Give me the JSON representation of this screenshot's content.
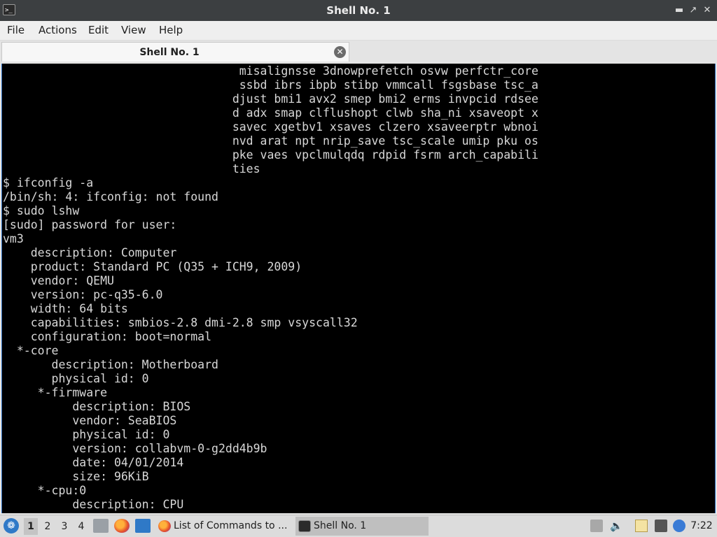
{
  "window": {
    "title": "Shell No. 1",
    "icon_glyph": ">_",
    "controls": [
      "minimize-icon",
      "maximize-icon",
      "close-icon"
    ]
  },
  "menu": {
    "items": [
      "File",
      "Actions",
      "Edit",
      "View",
      "Help"
    ]
  },
  "tabs": [
    {
      "label": "Shell No. 1",
      "close_icon": "close-circle-icon"
    }
  ],
  "terminal": {
    "colors": {
      "background": "#000000",
      "text": "#d8d8d8"
    },
    "lines": [
      "                                  misalignsse 3dnowprefetch osvw perfctr_core",
      "                                  ssbd ibrs ibpb stibp vmmcall fsgsbase tsc_a",
      "                                 djust bmi1 avx2 smep bmi2 erms invpcid rdsee",
      "                                 d adx smap clflushopt clwb sha_ni xsaveopt x",
      "                                 savec xgetbv1 xsaves clzero xsaveerptr wbnoi",
      "                                 nvd arat npt nrip_save tsc_scale umip pku os",
      "                                 pke vaes vpclmulqdq rdpid fsrm arch_capabili",
      "                                 ties",
      "$ ifconfig -a",
      "/bin/sh: 4: ifconfig: not found",
      "$ sudo lshw",
      "[sudo] password for user:",
      "vm3",
      "    description: Computer",
      "    product: Standard PC (Q35 + ICH9, 2009)",
      "    vendor: QEMU",
      "    version: pc-q35-6.0",
      "    width: 64 bits",
      "    capabilities: smbios-2.8 dmi-2.8 smp vsyscall32",
      "    configuration: boot=normal",
      "  *-core",
      "       description: Motherboard",
      "       physical id: 0",
      "     *-firmware",
      "          description: BIOS",
      "          vendor: SeaBIOS",
      "          physical id: 0",
      "          version: collabvm-0-g2dd4b9b",
      "          date: 04/01/2014",
      "          size: 96KiB",
      "     *-cpu:0",
      "          description: CPU"
    ]
  },
  "taskbar": {
    "start_icon": "start-menu-icon",
    "workspaces": [
      "1",
      "2",
      "3",
      "4"
    ],
    "active_workspace": "1",
    "launchers": [
      "file-manager-icon",
      "firefox-icon",
      "show-desktop-icon"
    ],
    "tasks": [
      {
        "label": "List of Commands to ...",
        "icon": "firefox-icon",
        "active": false
      },
      {
        "label": "Shell No. 1",
        "icon": "terminal-icon",
        "active": true
      }
    ],
    "tray": [
      "notification-icon",
      "volume-icon",
      "clipboard-icon",
      "network-icon",
      "update-notifier-icon"
    ],
    "clock": "7:22"
  }
}
